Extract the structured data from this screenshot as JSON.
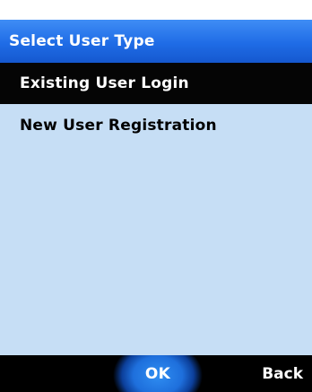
{
  "header": {
    "title": "Select User Type"
  },
  "menu": {
    "items": [
      {
        "label": "Existing User Login",
        "selected": true
      },
      {
        "label": "New User Registration",
        "selected": false
      }
    ]
  },
  "softkeys": {
    "ok_label": "OK",
    "back_label": "Back"
  },
  "colors": {
    "header_blue": "#1f6ce6",
    "content_bg": "#c6def5",
    "selected_bg": "#050505",
    "softkey_bg": "#000000",
    "ok_glow": "#2f8ef2"
  }
}
